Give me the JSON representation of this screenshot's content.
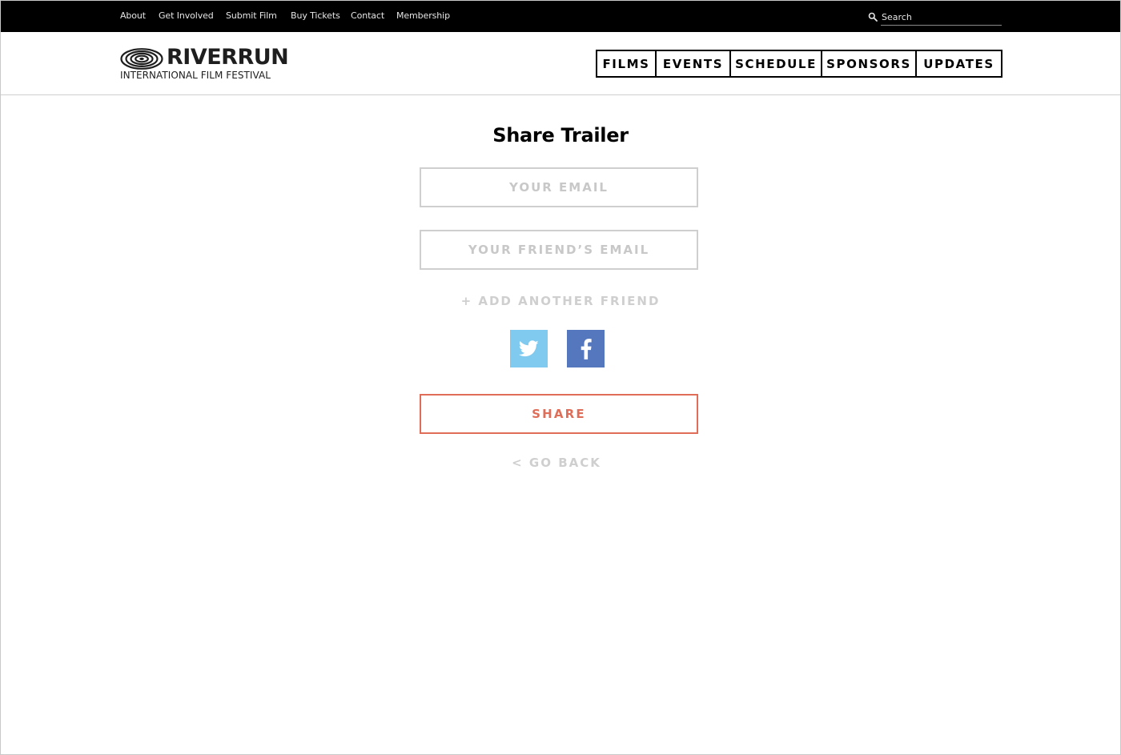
{
  "topbar": {
    "links": [
      "About",
      "Get Involved",
      "Submit Film",
      "Buy Tickets",
      "Contact",
      "Membership"
    ],
    "search_placeholder": "Search"
  },
  "header": {
    "logo_name": "RIVERRUN",
    "logo_sub": "INTERNATIONAL FILM FESTIVAL",
    "nav": [
      "FILMS",
      "EVENTS",
      "SCHEDULE",
      "SPONSORS",
      "UPDATES"
    ]
  },
  "main": {
    "title": "Share Trailer",
    "email_placeholder": "YOUR EMAIL",
    "friend_email_placeholder": "YOUR FRIEND’S EMAIL",
    "add_friend_label": "+ ADD ANOTHER FRIEND",
    "social": [
      "twitter-icon",
      "facebook-icon"
    ],
    "share_label": "SHARE",
    "go_back_label": "< GO BACK"
  },
  "colors": {
    "topbar_bg": "#000000",
    "accent": "#e06d57",
    "twitter": "#80c9ef",
    "facebook": "#5477bd",
    "muted": "#cfcfcf"
  }
}
